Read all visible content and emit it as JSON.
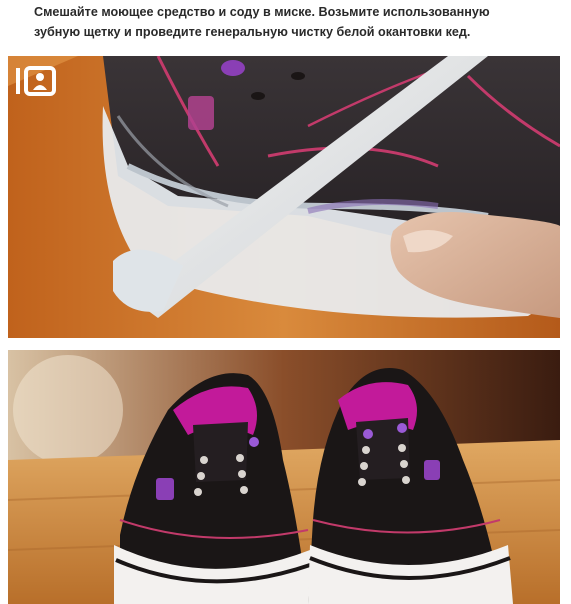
{
  "caption": {
    "line1": "Смешайте моющее средство и соду в миске. Возьмите использованную",
    "line2": "зубную щетку и проведите генеральную чистку белой окантовки кед."
  },
  "photos": [
    {
      "subject": "toothbrush-cleaning-sneaker-sole"
    },
    {
      "subject": "clean-black-sneakers-pair"
    }
  ],
  "colors": {
    "text": "#2a2a2a",
    "shoe_black": "#1a1616",
    "accent_purple": "#9a3fbf",
    "lining_magenta": "#c21a9a",
    "table_wood": "#c9853f",
    "sole_white": "#f3f1ef"
  },
  "icons": [
    "watermark-logo-icon"
  ]
}
